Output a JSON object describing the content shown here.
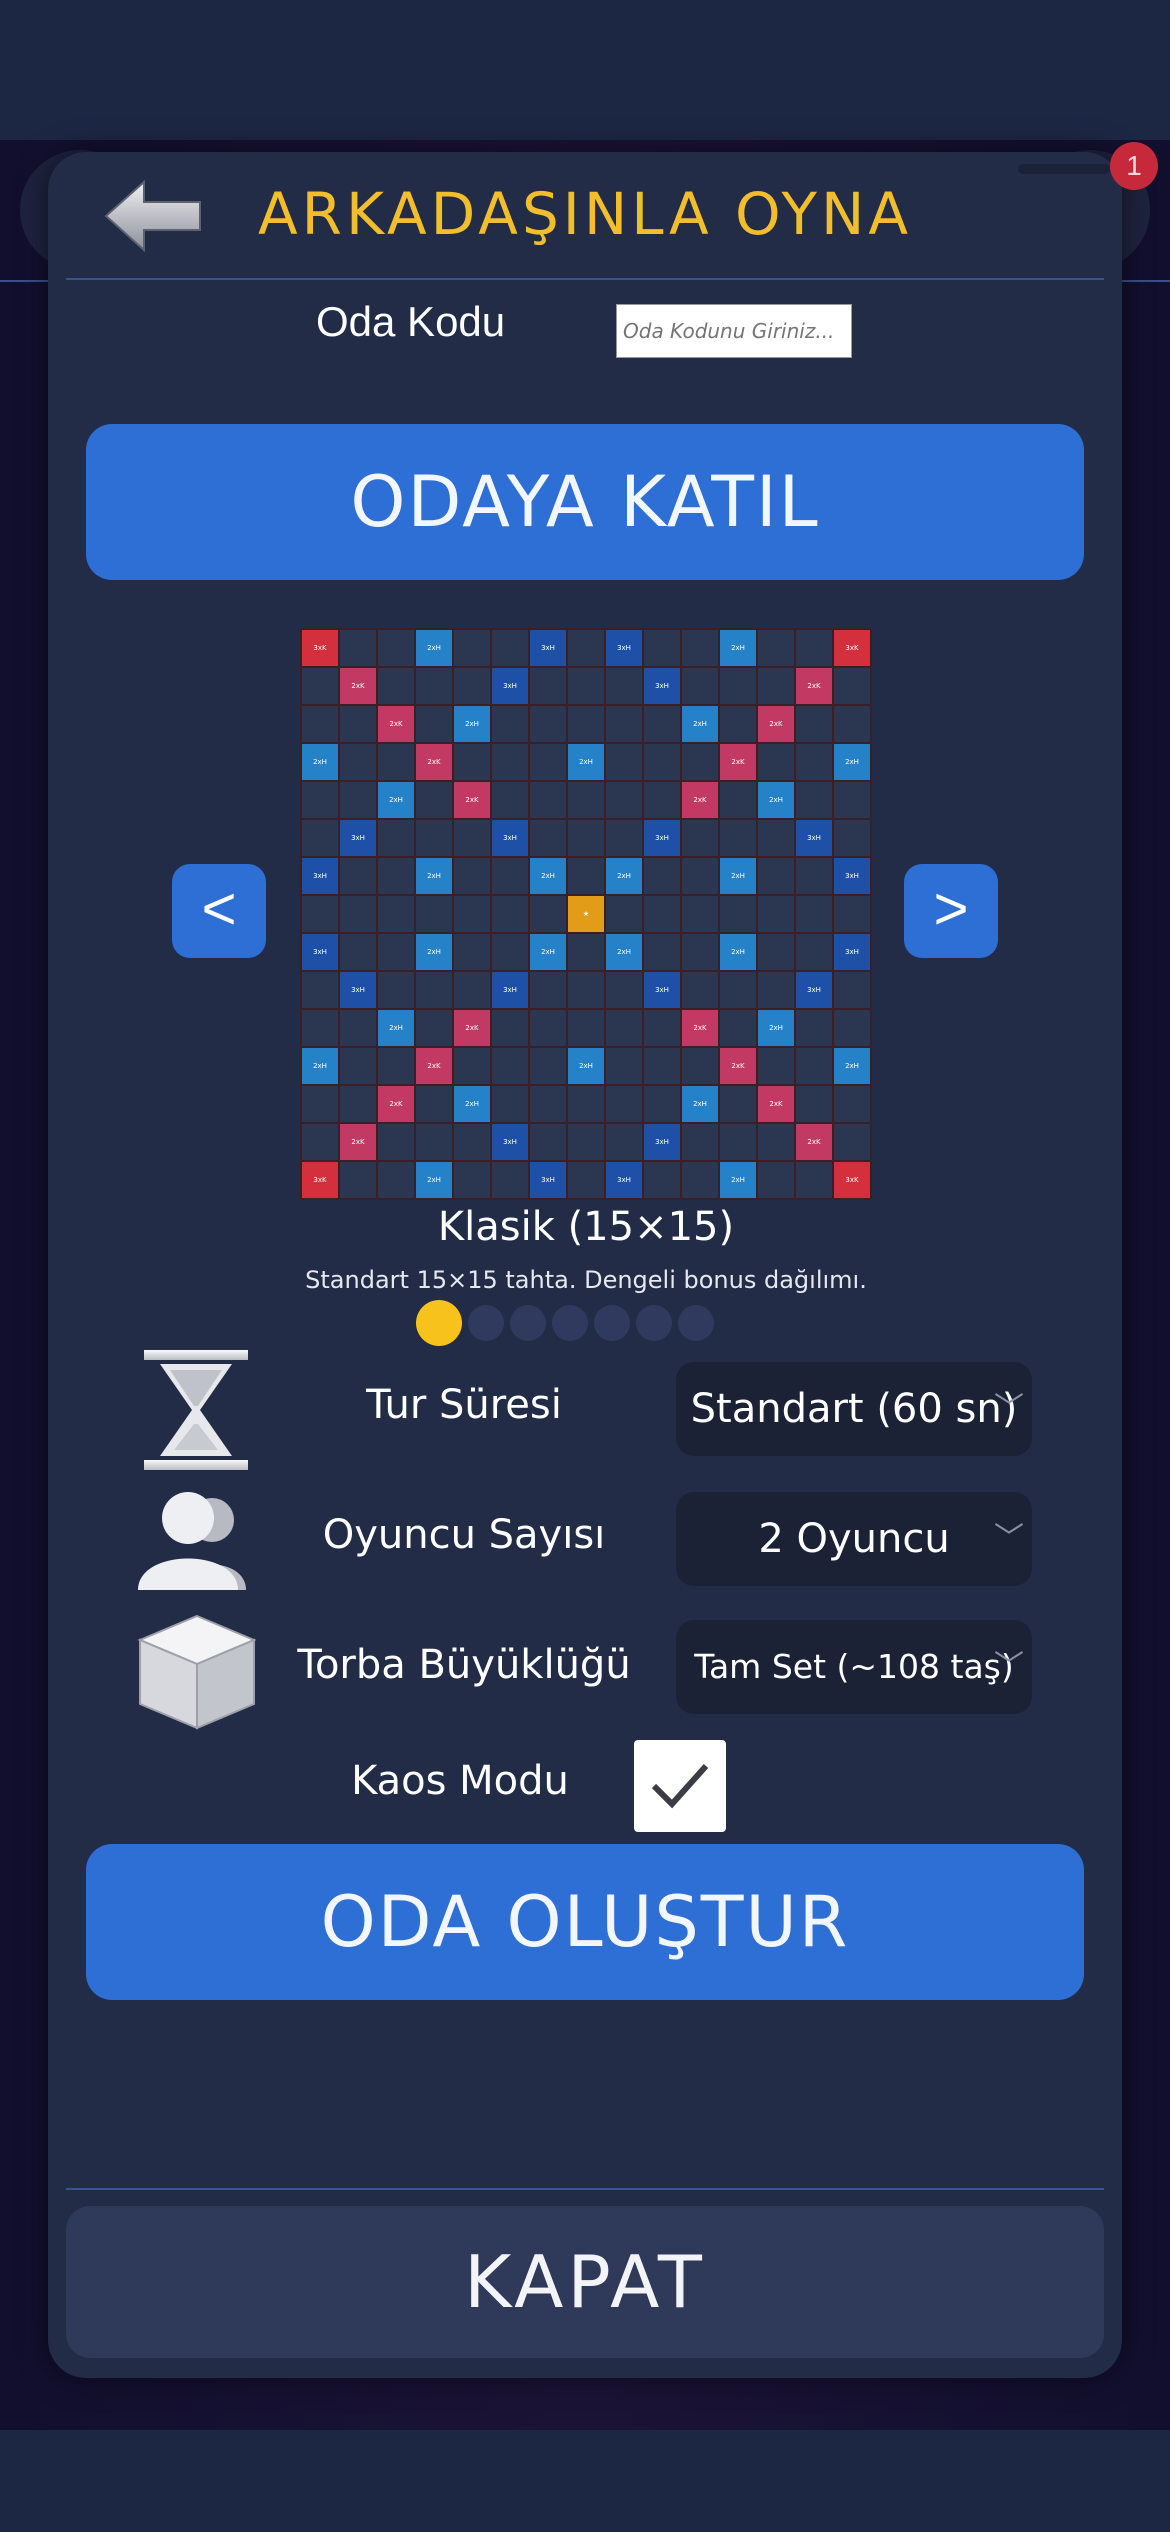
{
  "header": {
    "title": "ARKADAŞINLA OYNA",
    "notification_count": "1"
  },
  "room": {
    "label": "Oda Kodu",
    "input_value": "",
    "input_placeholder": "Oda Kodunu Giriniz..."
  },
  "join_button": "ODAYA KATIL",
  "board": {
    "name": "Klasik (15×15)",
    "description": "Standart 15×15 tahta. Dengeli bonus dağılımı.",
    "prev": "<",
    "next": ">",
    "page_count": 7,
    "active_page": 1,
    "bonus_labels": {
      "tw": "3xK",
      "dw": "2xK",
      "tl": "3xH",
      "dl": "2xH",
      "center": "★"
    },
    "colors": {
      "tw": "#d32f3c",
      "dw": "#c23a63",
      "tl": "#1f50a8",
      "dl": "#2582c9",
      "center": "#e39c18",
      "empty": "#2b3650"
    }
  },
  "options": {
    "turn_time": {
      "label": "Tur Süresi",
      "value": "Standart (60 sn)",
      "icon": "hourglass-icon"
    },
    "player_count": {
      "label": "Oyuncu Sayısı",
      "value": "2 Oyuncu",
      "icon": "players-icon"
    },
    "bag_size": {
      "label": "Torba Büyüklüğü",
      "value": "Tam Set (~108 taş)",
      "icon": "box-icon"
    }
  },
  "chaos": {
    "label": "Kaos Modu",
    "checked": true
  },
  "create_button": "ODA OLUŞTUR",
  "close_button": "KAPAT",
  "colors": {
    "accent": "#2e6fd6",
    "title": "#f3be2c",
    "modal": "#222c47"
  }
}
